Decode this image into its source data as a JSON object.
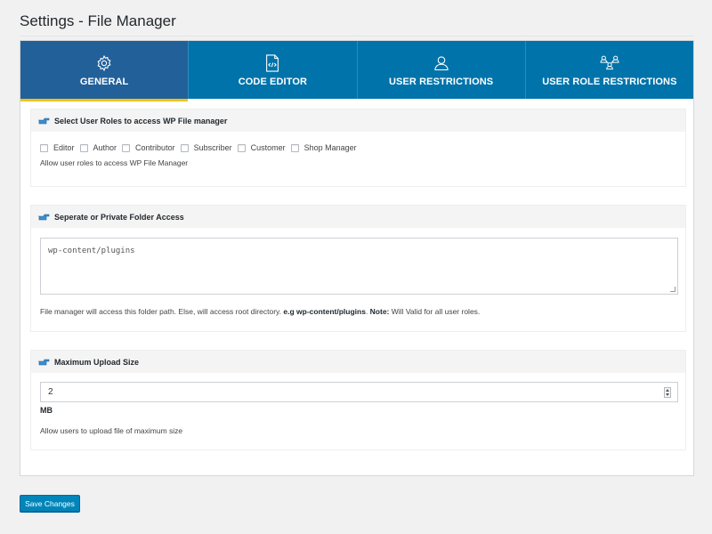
{
  "page": {
    "title": "Settings - File Manager"
  },
  "tabs": [
    {
      "label": "GENERAL",
      "icon": "gear-icon",
      "active": true
    },
    {
      "label": "CODE EDITOR",
      "icon": "code-file-icon",
      "active": false
    },
    {
      "label": "USER RESTRICTIONS",
      "icon": "user-icon",
      "active": false
    },
    {
      "label": "USER ROLE RESTRICTIONS",
      "icon": "user-role-network-icon",
      "active": false
    }
  ],
  "roles_section": {
    "title": "Select User Roles to access WP File manager",
    "roles": [
      {
        "label": "Editor",
        "checked": false
      },
      {
        "label": "Author",
        "checked": false
      },
      {
        "label": "Contributor",
        "checked": false
      },
      {
        "label": "Subscriber",
        "checked": false
      },
      {
        "label": "Customer",
        "checked": false
      },
      {
        "label": "Shop Manager",
        "checked": false
      }
    ],
    "help": "Allow user roles to access WP File Manager"
  },
  "folder_section": {
    "title": "Seperate or Private Folder Access",
    "placeholder": "wp-content/plugins",
    "value": "",
    "help_prefix": "File manager will access this folder path. Else, will access root directory. ",
    "help_example": "e.g wp-content/plugins",
    "help_mid": ". ",
    "help_note_label": "Note:",
    "help_note": " Will Valid for all user roles."
  },
  "upload_section": {
    "title": "Maximum Upload Size",
    "value": "2",
    "unit": "MB",
    "help": "Allow users to upload file of maximum size"
  },
  "actions": {
    "save_label": "Save Changes"
  },
  "colors": {
    "tab_bg": "#0073aa",
    "tab_active": "#22609a",
    "tab_underline": "#f0c419",
    "button": "#0085ba"
  }
}
